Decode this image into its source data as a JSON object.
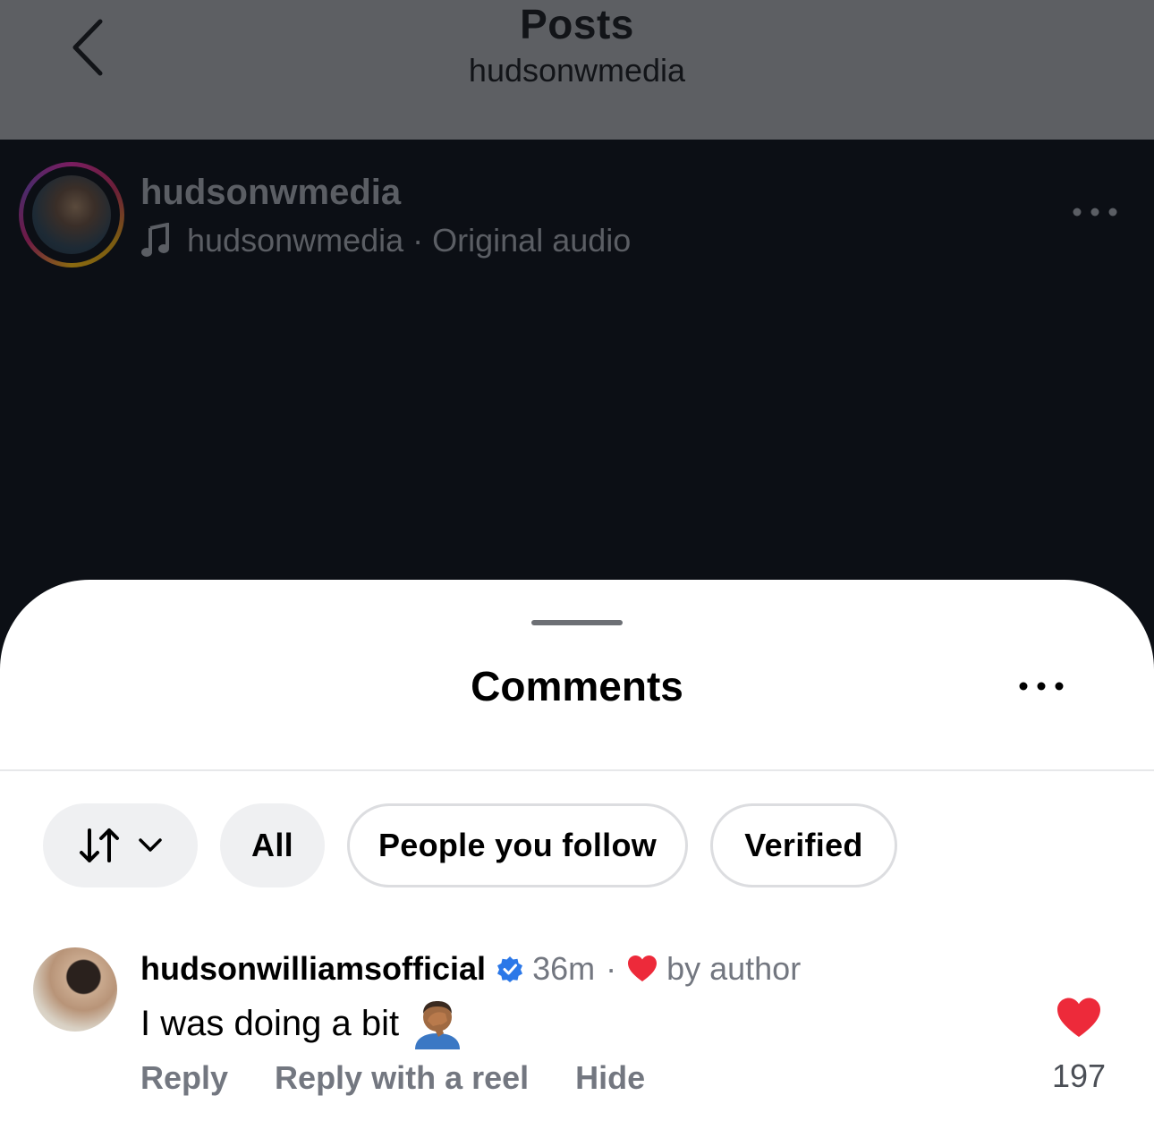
{
  "header": {
    "title": "Posts",
    "subtitle": "hudsonwmedia",
    "back_icon": "chevron-left-icon"
  },
  "post": {
    "username": "hudsonwmedia",
    "audio_owner": "hudsonwmedia",
    "audio_separator": "·",
    "audio_label": "Original audio",
    "audio_icon": "music-note-icon",
    "more_icon": "more-horizontal-icon"
  },
  "comments_sheet": {
    "title": "Comments",
    "more_icon": "more-horizontal-icon",
    "filters": {
      "sort_icon": "sort-arrows-icon",
      "chevron_icon": "chevron-down-icon",
      "chips": [
        {
          "label": "All",
          "selected": true
        },
        {
          "label": "People you follow",
          "selected": false
        },
        {
          "label": "Verified",
          "selected": false
        }
      ]
    },
    "comments": [
      {
        "username": "hudsonwilliamsofficial",
        "verified": true,
        "time": "36m",
        "separator": "·",
        "liked_by_author_label": "by author",
        "text": "I was doing a bit",
        "emoji": "face-palm-emoji",
        "actions": {
          "reply": "Reply",
          "reply_reel": "Reply with a reel",
          "hide": "Hide"
        },
        "like_count": "197",
        "liked": true
      }
    ]
  },
  "colors": {
    "heart_red": "#ed2a3a",
    "verified_blue": "#2b78e8",
    "muted_text": "#737780"
  }
}
